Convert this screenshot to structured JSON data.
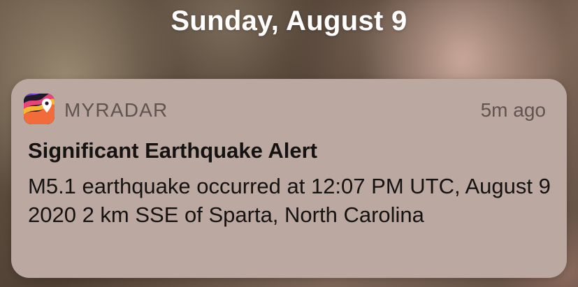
{
  "lock_screen": {
    "date": "Sunday, August 9"
  },
  "notification": {
    "app_name": "MYRADAR",
    "app_icon": "myradar-app-icon",
    "timestamp": "5m ago",
    "title": "Significant Earthquake Alert",
    "body": "M5.1 earthquake occurred at 12:07 PM UTC, August 9 2020 2 km SSE of Sparta, North Carolina"
  },
  "colors": {
    "card_background": "#bba8a0",
    "header_text": "#5f5450",
    "body_text": "#151212",
    "date_text": "#ffffff"
  }
}
